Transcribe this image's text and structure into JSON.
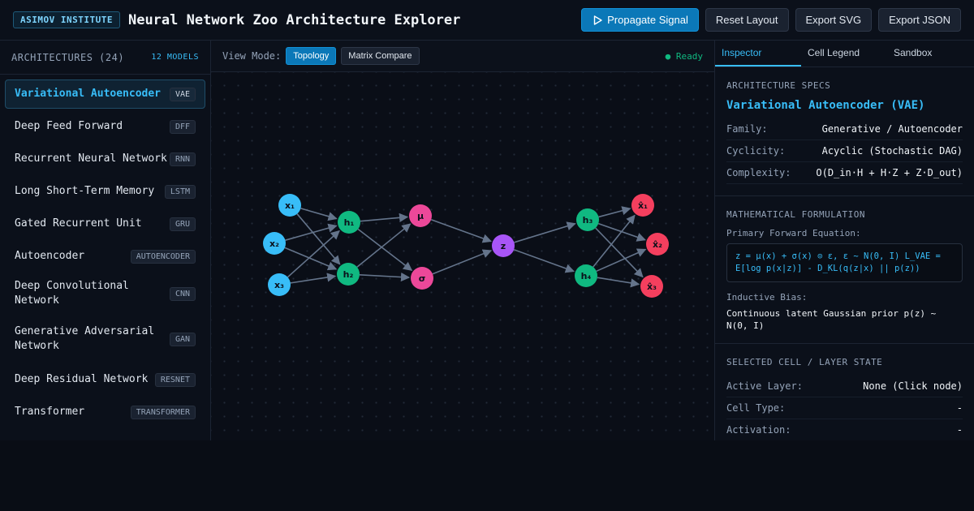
{
  "header": {
    "brand": "ASIMOV INSTITUTE",
    "title": "Neural Network Zoo Architecture Explorer",
    "actions": {
      "propagate": "Propagate Signal",
      "reset": "Reset Layout",
      "export_svg": "Export SVG",
      "export_json": "Export JSON"
    }
  },
  "sidebar": {
    "title": "ARCHITECTURES (24)",
    "count": "12 MODELS",
    "items": [
      {
        "name": "Variational Autoencoder",
        "tag": "VAE"
      },
      {
        "name": "Deep Feed Forward",
        "tag": "DFF"
      },
      {
        "name": "Recurrent Neural Network",
        "tag": "RNN"
      },
      {
        "name": "Long Short-Term Memory",
        "tag": "LSTM"
      },
      {
        "name": "Gated Recurrent Unit",
        "tag": "GRU"
      },
      {
        "name": "Autoencoder",
        "tag": "AUTOENCODER"
      },
      {
        "name": "Deep Convolutional Network",
        "tag": "CNN"
      },
      {
        "name": "Generative Adversarial Network",
        "tag": "GAN"
      },
      {
        "name": "Deep Residual Network",
        "tag": "RESNET"
      },
      {
        "name": "Transformer",
        "tag": "TRANSFORMER"
      }
    ]
  },
  "toolbar": {
    "view_label": "View Mode:",
    "topology": "Topology",
    "matrix": "Matrix Compare",
    "status": "● Ready"
  },
  "graph": {
    "nodes": [
      {
        "id": "x1",
        "label": "x₁",
        "kind": "input"
      },
      {
        "id": "x2",
        "label": "x₂",
        "kind": "input"
      },
      {
        "id": "x3",
        "label": "x₃",
        "kind": "input"
      },
      {
        "id": "h1",
        "label": "h₁",
        "kind": "hidden"
      },
      {
        "id": "h2",
        "label": "h₂",
        "kind": "hidden"
      },
      {
        "id": "mu",
        "label": "μ",
        "kind": "stat"
      },
      {
        "id": "sigma",
        "label": "σ",
        "kind": "stat"
      },
      {
        "id": "z",
        "label": "z",
        "kind": "latent"
      },
      {
        "id": "h3",
        "label": "h₃",
        "kind": "hidden"
      },
      {
        "id": "h4",
        "label": "h₄",
        "kind": "hidden"
      },
      {
        "id": "o1",
        "label": "x̂₁",
        "kind": "output"
      },
      {
        "id": "o2",
        "label": "x̂₂",
        "kind": "output"
      },
      {
        "id": "o3",
        "label": "x̂₃",
        "kind": "output"
      }
    ],
    "edges": [
      [
        "x1",
        "h1"
      ],
      [
        "x1",
        "h2"
      ],
      [
        "x2",
        "h1"
      ],
      [
        "x2",
        "h2"
      ],
      [
        "x3",
        "h1"
      ],
      [
        "x3",
        "h2"
      ],
      [
        "h1",
        "mu"
      ],
      [
        "h1",
        "sigma"
      ],
      [
        "h2",
        "mu"
      ],
      [
        "h2",
        "sigma"
      ],
      [
        "mu",
        "z"
      ],
      [
        "sigma",
        "z"
      ],
      [
        "z",
        "h3"
      ],
      [
        "z",
        "h4"
      ],
      [
        "h3",
        "o1"
      ],
      [
        "h3",
        "o2"
      ],
      [
        "h3",
        "o3"
      ],
      [
        "h4",
        "o1"
      ],
      [
        "h4",
        "o2"
      ],
      [
        "h4",
        "o3"
      ]
    ],
    "colors": {
      "input": "#38bdf8",
      "hidden": "#10b981",
      "stat": "#ec4899",
      "latent": "#a855f7",
      "output": "#f43f5e",
      "edge": "#64748b"
    }
  },
  "panel": {
    "tabs": [
      "Inspector",
      "Cell Legend",
      "Sandbox"
    ],
    "specs": {
      "title": "ARCHITECTURE SPECS",
      "heading": "Variational Autoencoder (VAE)",
      "rows": [
        {
          "k": "Family:",
          "v": "Generative / Autoencoder"
        },
        {
          "k": "Cyclicity:",
          "v": "Acyclic (Stochastic DAG)"
        },
        {
          "k": "Complexity:",
          "v": "O(D_in·H + H·Z + Z·D_out)"
        }
      ]
    },
    "math": {
      "title": "MATHEMATICAL FORMULATION",
      "eq_label": "Primary Forward Equation:",
      "equation": "z = μ(x) + σ(x) ⊙ ε, ε ~ N(0, I) L_VAE = E[log p(x|z)] - D_KL(q(z|x) || p(z))",
      "bias_label": "Inductive Bias:",
      "bias": "Continuous latent Gaussian prior p(z) ~ N(0, I)"
    },
    "state": {
      "title": "SELECTED CELL / LAYER STATE",
      "rows": [
        {
          "k": "Active Layer:",
          "v": "None (Click node)"
        },
        {
          "k": "Cell Type:",
          "v": "-"
        },
        {
          "k": "Activation:",
          "v": "-"
        }
      ]
    }
  }
}
